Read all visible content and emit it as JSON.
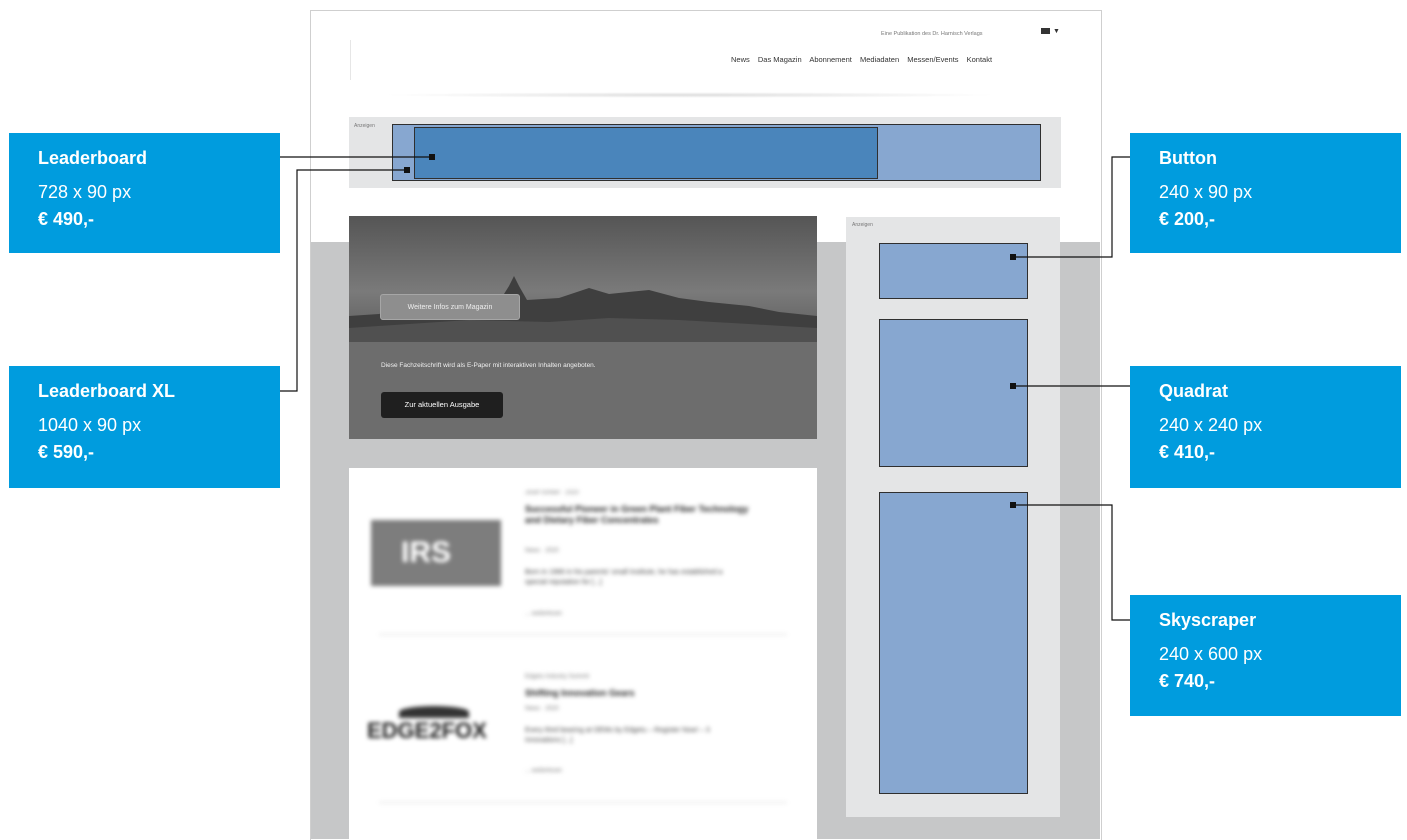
{
  "site": {
    "publisher_text": "Eine Publikation des Dr. Harnisch Verlags",
    "nav": [
      "News",
      "Das Magazin",
      "Abonnement",
      "Mediadaten",
      "Messen/Events",
      "Kontakt"
    ],
    "ad_label": "Anzeigen"
  },
  "hero": {
    "more_button": "Weitere Infos zum Magazin",
    "text": "Diese Fachzeitschrift wird als E-Paper mit interaktiven Inhalten angeboten.",
    "cta": "Zur aktuellen Ausgabe"
  },
  "articles": [
    {
      "logo_text": "IRS",
      "meta": "Josef Scheer · 2020",
      "title": "Successful Pioneer in Green Plant Fiber Technology and Dietary Fiber Concentrates",
      "date": "News · 2020",
      "body": "Born in 1966 in his parents' small Institute, he has established a special reputation for [...]",
      "more": "... weiterlesen"
    },
    {
      "logo_text": "EDGE2FOX",
      "meta": "Edgetu Industry Summit",
      "title": "Shifting Innovation Gears",
      "date": "News · 2020",
      "body": "Every third bearing at OEMs by Edgetu – Register Now! – 3 Innovations [...]",
      "more": "... weiterlesen"
    }
  ],
  "callouts": {
    "leaderboard": {
      "title": "Leaderboard",
      "size": "728 x 90 px",
      "price": "€ 490,-"
    },
    "leaderboard_xl": {
      "title": "Leaderboard XL",
      "size": "1040 x 90 px",
      "price": "€ 590,-"
    },
    "button": {
      "title": "Button",
      "size": "240 x 90 px",
      "price": "€ 200,-"
    },
    "quadrat": {
      "title": "Quadrat",
      "size": "240 x 240 px",
      "price": "€ 410,-"
    },
    "skyscraper": {
      "title": "Skyscraper",
      "size": "240 x 600 px",
      "price": "€ 740,-"
    }
  },
  "colors": {
    "callout_bg": "#009cde",
    "ad_slot": "#87a7d0",
    "ad_slot_dark": "#4a85bb",
    "zone_bg": "#e4e5e6"
  }
}
